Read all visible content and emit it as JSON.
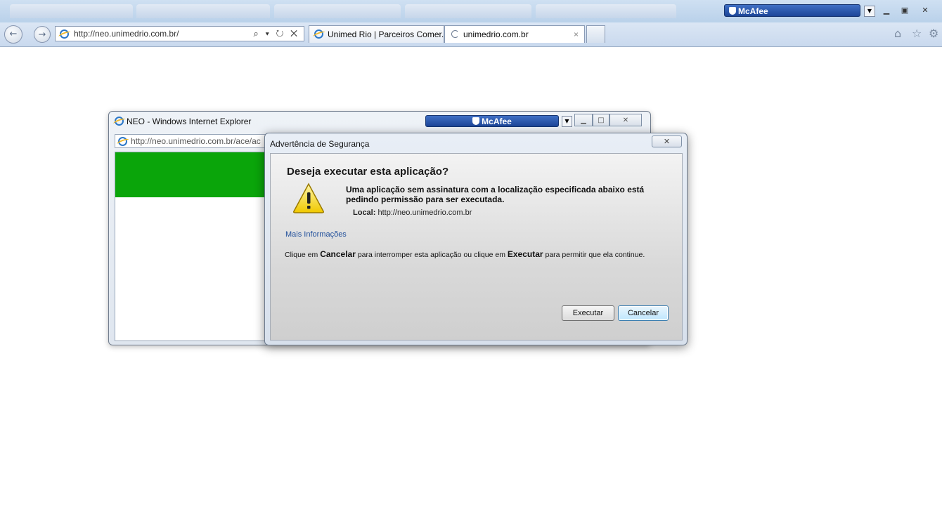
{
  "browser": {
    "mcafee_label": "McAfee",
    "address": "http://neo.unimedrio.com.br/",
    "address_controls": "⌕ ▾ ↻ ✕",
    "tabs": [
      {
        "label": "Unimed Rio | Parceiros Comer..."
      },
      {
        "label": "unimedrio.com.br",
        "close": "×"
      }
    ],
    "window_controls": [
      "▁",
      "▣",
      "✕"
    ],
    "toolbar_icons": {
      "home": "⌂",
      "favorites": "☆",
      "tools": "⚙"
    }
  },
  "neo_window": {
    "title": "NEO - Windows Internet Explorer",
    "mcafee_label": "McAfee",
    "address": "http://neo.unimedrio.com.br/ace/ac",
    "controls": [
      "▁",
      "□",
      "✕"
    ]
  },
  "dialog": {
    "title": "Advertência de Segurança",
    "close": "✕",
    "heading": "Deseja executar esta aplicação?",
    "message": "Uma aplicação sem assinatura com a localização especificada abaixo está pedindo permissão para ser executada.",
    "location_label": "Local:",
    "location_value": "http://neo.unimedrio.com.br",
    "more_info": "Mais Informações",
    "instruction": {
      "part1": "Clique em ",
      "cancel_word": "Cancelar",
      "part2": " para interromper esta aplicação ou clique em ",
      "exec_word": "Executar",
      "part3": " para permitir que ela continue."
    },
    "buttons": {
      "execute": "Executar",
      "cancel": "Cancelar"
    }
  },
  "colors": {
    "content_green": "#0aa50a",
    "mcafee_blue": "#1c4598"
  }
}
